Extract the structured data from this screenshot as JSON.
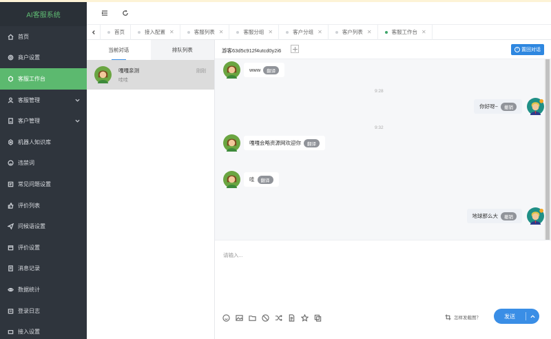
{
  "app": {
    "brand": "AI客服系统"
  },
  "sidebar": {
    "items": [
      {
        "label": "首页",
        "icon": "home-icon"
      },
      {
        "label": "商户设置",
        "icon": "gear-icon"
      },
      {
        "label": "客服工作台",
        "icon": "workbench-icon",
        "active": true
      },
      {
        "label": "客服管理",
        "icon": "user-icon",
        "expandable": true
      },
      {
        "label": "客户管理",
        "icon": "customer-icon",
        "expandable": true
      },
      {
        "label": "机器人知识库",
        "icon": "robot-icon"
      },
      {
        "label": "违禁词",
        "icon": "ban-icon"
      },
      {
        "label": "常见问题设置",
        "icon": "faq-icon"
      },
      {
        "label": "评价列表",
        "icon": "thumb-icon"
      },
      {
        "label": "问候语设置",
        "icon": "send-icon"
      },
      {
        "label": "评价设置",
        "icon": "calendar-icon"
      },
      {
        "label": "消息记录",
        "icon": "record-icon"
      },
      {
        "label": "数据统计",
        "icon": "stats-icon"
      },
      {
        "label": "登录日志",
        "icon": "log-icon"
      },
      {
        "label": "接入设置",
        "icon": "link-icon"
      }
    ]
  },
  "tabs": [
    {
      "label": "首页",
      "closable": false
    },
    {
      "label": "接入配置",
      "closable": true
    },
    {
      "label": "客服列表",
      "closable": true
    },
    {
      "label": "客服分组",
      "closable": true
    },
    {
      "label": "客户分组",
      "closable": true
    },
    {
      "label": "客户列表",
      "closable": true
    },
    {
      "label": "客服工作台",
      "closable": true,
      "active": true
    }
  ],
  "conversations": {
    "tab_current": "当前对话",
    "tab_queue": "排队列表",
    "items": [
      {
        "name": "嘎嘎亲测",
        "preview": "哇哇",
        "time": "刚刚"
      }
    ]
  },
  "chat": {
    "visitor_id": "游客63d5c912f4utcd0y2i6",
    "return_label": "置回对话",
    "translate_label": "翻译",
    "revoke_label": "撤销",
    "messages": [
      {
        "dir": "in",
        "text": "www",
        "action": "翻译"
      },
      {
        "dir": "time",
        "text": "9:28"
      },
      {
        "dir": "out",
        "text": "你好呀~",
        "action": "撤销"
      },
      {
        "dir": "time",
        "text": "9:32"
      },
      {
        "dir": "in",
        "text": "嘎嘎会略资源网欢迎你",
        "action": "翻译"
      },
      {
        "dir": "in",
        "text": "哇",
        "action": "翻译"
      },
      {
        "dir": "out",
        "text": "地球那么大",
        "action": "撤销"
      }
    ],
    "input_placeholder": "请输入...",
    "screenshot_tip": "怎样发截图？",
    "send_label": "发送",
    "tools": [
      "emoji-icon",
      "image-icon",
      "folder-icon",
      "ban-icon",
      "shuffle-icon",
      "file-icon",
      "star-icon",
      "copy-icon"
    ]
  }
}
